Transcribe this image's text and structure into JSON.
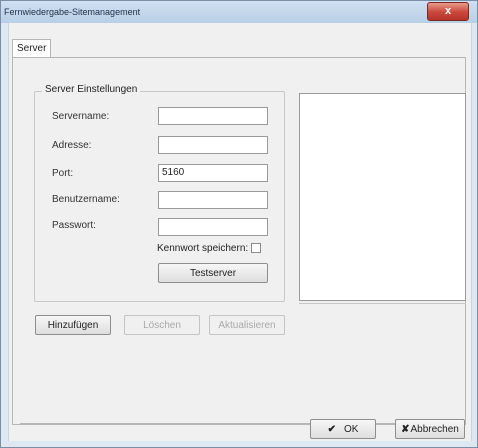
{
  "window": {
    "title": "Fernwiedergabe-Sitemanagement",
    "close_glyph": "x"
  },
  "tabs": [
    {
      "label": "Server"
    }
  ],
  "group": {
    "title": "Server Einstellungen"
  },
  "fields": {
    "servername": {
      "label": "Servername:",
      "value": ""
    },
    "adresse": {
      "label": "Adresse:",
      "value": ""
    },
    "port": {
      "label": "Port:",
      "value": "5160"
    },
    "benutzername": {
      "label": "Benutzername:",
      "value": ""
    },
    "passwort": {
      "label": "Passwort:",
      "value": ""
    }
  },
  "save_password": {
    "label": "Kennwort speichern:",
    "checked": false
  },
  "buttons": {
    "testserver": "Testserver",
    "hinzufuegen": "Hinzufügen",
    "loeschen": "Löschen",
    "aktualisieren": "Aktualisieren",
    "ok": "OK",
    "ok_icon": "✔",
    "abbrechen": "Abbrechen",
    "abbrechen_icon": "✘"
  }
}
